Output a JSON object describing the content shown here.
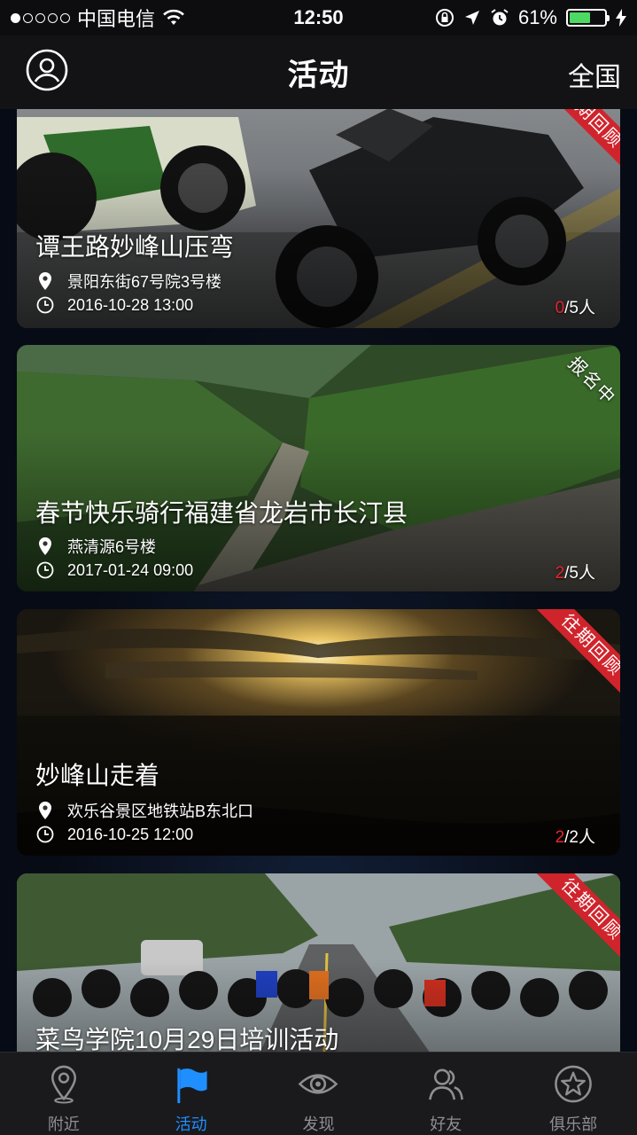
{
  "status_bar": {
    "carrier": "中国电信",
    "time": "12:50",
    "battery": "61%",
    "battery_level": 0.61
  },
  "nav": {
    "title": "活动",
    "region": "全国"
  },
  "colors": {
    "accent": "#1f8fff",
    "joined": "#e8252c",
    "ribbon": "#d0242c"
  },
  "activities": [
    {
      "title": "谭王路妙峰山压弯",
      "address": "景阳东街67号院3号楼",
      "datetime": "2016-10-28 13:00",
      "joined": "0",
      "capacity": "/5人",
      "badge": "往期回顾"
    },
    {
      "title": "春节快乐骑行福建省龙岩市长汀县",
      "address": "燕清源6号楼",
      "datetime": "2017-01-24 09:00",
      "joined": "2",
      "capacity": "/5人",
      "badge": "报名中"
    },
    {
      "title": "妙峰山走着",
      "address": "欢乐谷景区地铁站B东北口",
      "datetime": "2016-10-25 12:00",
      "joined": "2",
      "capacity": "/2人",
      "badge": "往期回顾"
    },
    {
      "title": "菜鸟学院10月29日培训活动",
      "badge": "往期回顾"
    }
  ],
  "tabs": [
    {
      "label": "附近",
      "icon": "location-pin-icon"
    },
    {
      "label": "活动",
      "icon": "flag-icon"
    },
    {
      "label": "发现",
      "icon": "eye-icon"
    },
    {
      "label": "好友",
      "icon": "friends-icon"
    },
    {
      "label": "俱乐部",
      "icon": "star-badge-icon"
    }
  ]
}
